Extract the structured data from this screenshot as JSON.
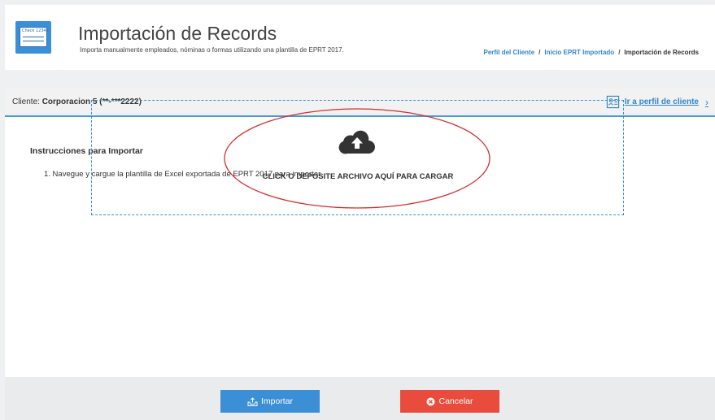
{
  "header": {
    "title": "Importación de Records",
    "subtitle": "Importa manualmente empleados, nóminas o formas utilizando una plantilla de EPRT 2017.",
    "icon": "check-card-icon",
    "icon_text": "Check   12345",
    "breadcrumb": {
      "items": [
        "Perfil del Cliente",
        "Inicio EPRT Importado"
      ],
      "separator": "/",
      "current": "Importación de Records"
    }
  },
  "client_bar": {
    "label": "Cliente:",
    "client_name": "Corporacion 5 (**-***2222)",
    "profile_link": "Ir a perfil de cliente",
    "chevron": "›"
  },
  "instructions": {
    "title": "Instrucciones para Importar",
    "steps": [
      "1.  Navegue y cargue la plantilla de Excel exportada de EPRT 2017 para importar."
    ]
  },
  "dropzone": {
    "text": "CLICK O DEPOSITE ARCHIVO AQUÍ PARA CARGAR",
    "icon": "cloud-upload-icon"
  },
  "footer": {
    "import_label": "Importar",
    "cancel_label": "Cancelar"
  },
  "colors": {
    "accent": "#3b8fd6",
    "link": "#2e86c9",
    "danger": "#e94b3c",
    "annotation": "#d32f2f"
  }
}
